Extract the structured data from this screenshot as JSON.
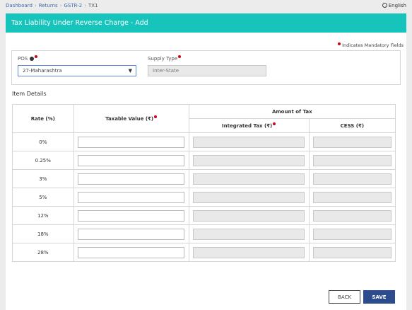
{
  "breadcrumb": {
    "items": [
      "Dashboard",
      "Returns",
      "GSTR-2",
      "TX1"
    ],
    "separator": "›"
  },
  "language": "English",
  "header": {
    "title": "Tax Liability Under Reverse Charge - Add"
  },
  "mandatory_note": "Indicates Mandatory Fields",
  "form": {
    "pos": {
      "label": "POS",
      "value": "27-Maharashtra",
      "caret": "▼"
    },
    "supply_type": {
      "label": "Supply Type",
      "value": "Inter-State"
    }
  },
  "item_details": {
    "title": "Item Details",
    "columns": {
      "rate": "Rate (%)",
      "taxable_value": "Taxable Value (₹)",
      "amount_of_tax": "Amount of Tax",
      "integrated_tax": "Integrated Tax (₹)",
      "cess": "CESS (₹)"
    },
    "rows": [
      {
        "rate": "0%"
      },
      {
        "rate": "0.25%"
      },
      {
        "rate": "3%"
      },
      {
        "rate": "5%"
      },
      {
        "rate": "12%"
      },
      {
        "rate": "18%"
      },
      {
        "rate": "28%"
      }
    ]
  },
  "buttons": {
    "back": "BACK",
    "save": "SAVE"
  },
  "colors": {
    "header_bg": "#17c4bb",
    "save_bg": "#2d4c8d",
    "required_dot": "#d0021b"
  }
}
